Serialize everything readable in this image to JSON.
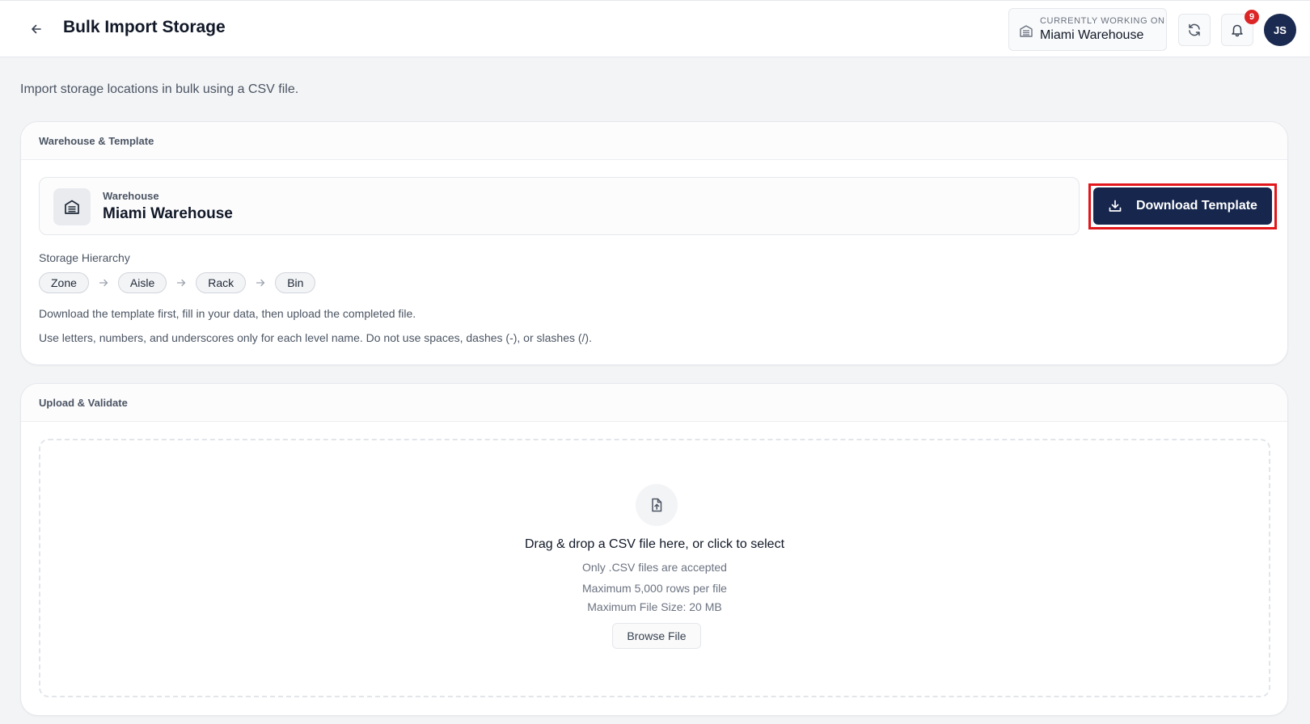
{
  "header": {
    "title": "Bulk Import Storage",
    "working_label": "CURRENTLY WORKING ON",
    "working_value": "Miami Warehouse",
    "notification_count": "9",
    "avatar_initials": "JS"
  },
  "subtitle": "Import storage locations in bulk using a CSV file.",
  "template_card": {
    "title": "Warehouse & Template",
    "warehouse_label": "Warehouse",
    "warehouse_value": "Miami Warehouse",
    "download_button": "Download Template",
    "hierarchy_label": "Storage Hierarchy",
    "hierarchy": [
      "Zone",
      "Aisle",
      "Rack",
      "Bin"
    ],
    "note1": "Download the template first, fill in your data, then upload the completed file.",
    "note2": "Use letters, numbers, and underscores only for each level name. Do not use spaces, dashes (-), or slashes (/)."
  },
  "upload_card": {
    "title": "Upload & Validate",
    "drop_title": "Drag & drop a CSV file here, or click to select",
    "line1": "Only .CSV files are accepted",
    "line2": "Maximum 5,000 rows per file",
    "line3": "Maximum File Size: 20 MB",
    "browse_button": "Browse File"
  },
  "colors": {
    "primary": "#16264d",
    "highlight": "#e3161b",
    "badge": "#dc2626"
  }
}
